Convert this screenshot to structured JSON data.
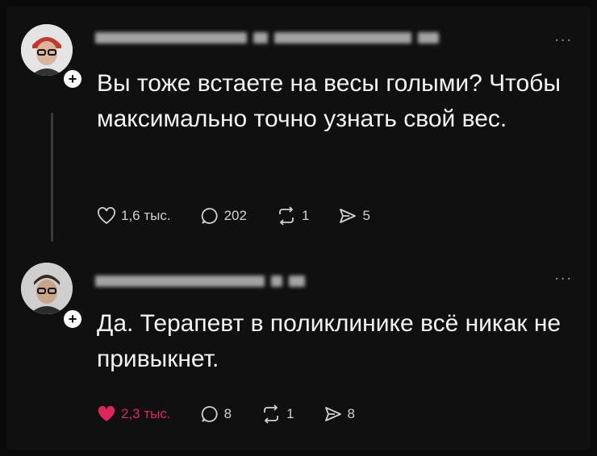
{
  "posts": [
    {
      "text": "Вы тоже встаете на весы голыми? Чтобы максимально точно узнать свой вес.",
      "actions": {
        "likes": "1,6 тыс.",
        "comments": "202",
        "reposts": "1",
        "shares": "5"
      },
      "liked": false
    },
    {
      "text": "Да. Терапевт в поликлинике всё никак не привыкнет.",
      "actions": {
        "likes": "2,3 тыс.",
        "comments": "8",
        "reposts": "1",
        "shares": "8"
      },
      "liked": true
    }
  ],
  "icons": {
    "like": "heart-icon",
    "comment": "speech-bubble-icon",
    "repost": "repost-icon",
    "share": "send-icon",
    "more": "more-icon",
    "follow": "plus-icon"
  },
  "colors": {
    "background": "#101010",
    "text": "#f4f4f4",
    "like_active": "#e0245e",
    "muted": "#d0d0d0"
  },
  "more_label": "...",
  "follow_label": "+"
}
